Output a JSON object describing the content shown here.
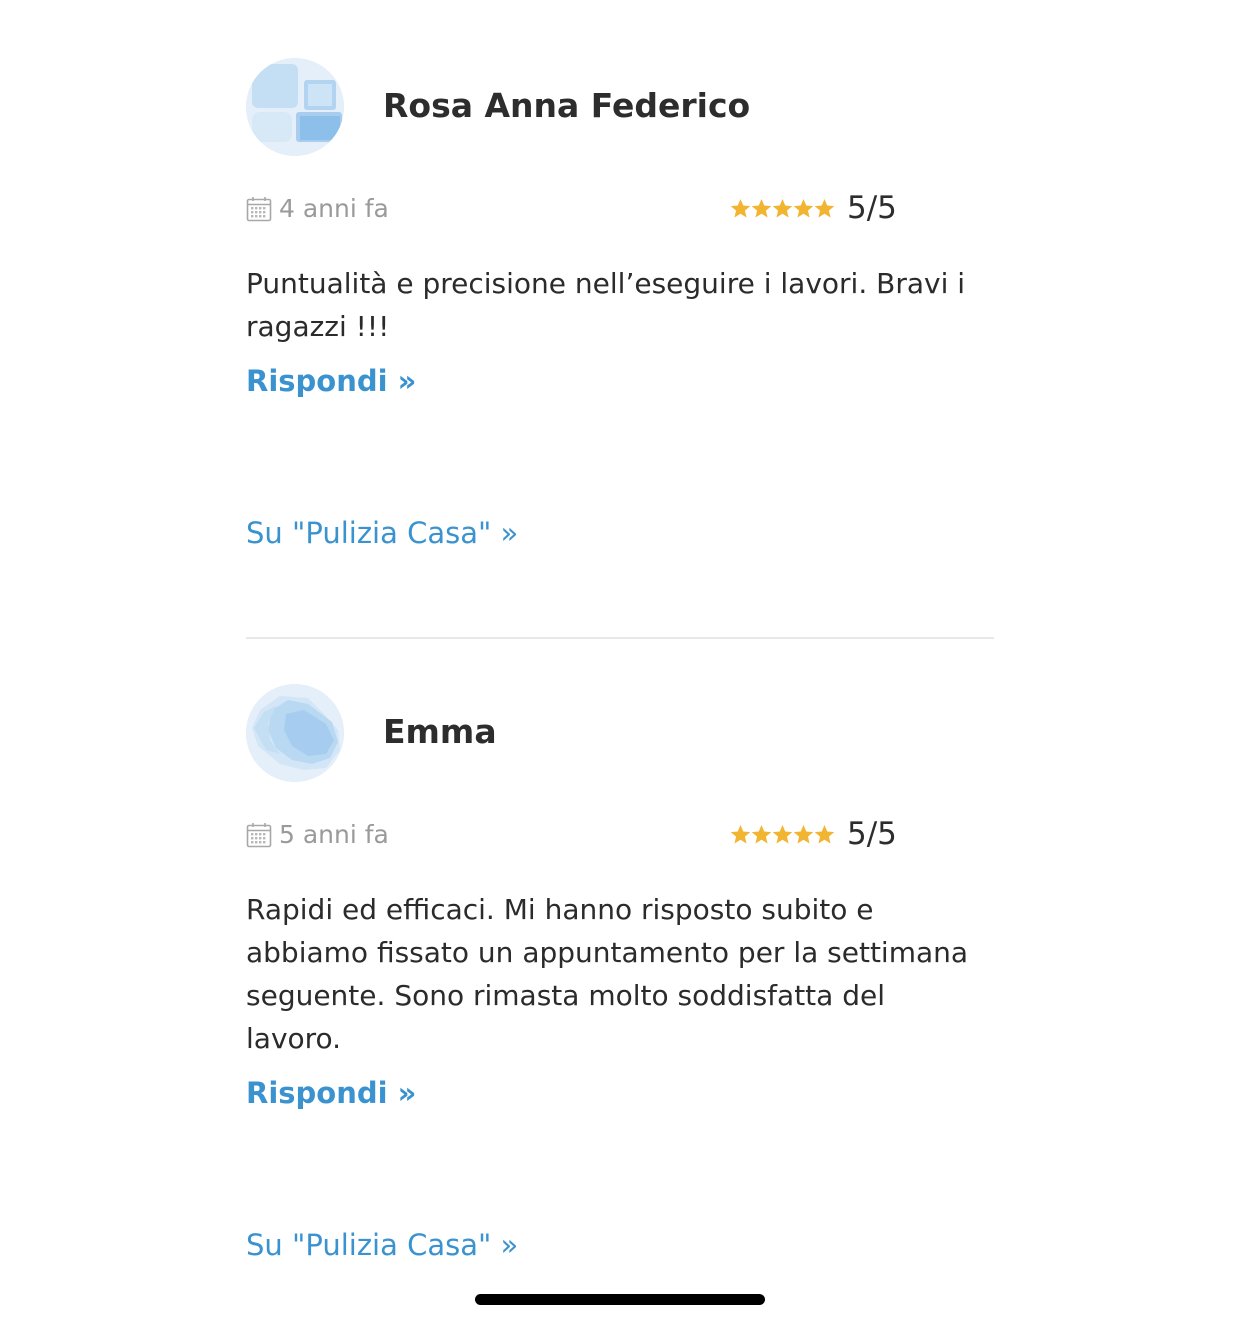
{
  "reviews": [
    {
      "author": "Rosa Anna Federico",
      "date": "4 anni fa",
      "stars": 5,
      "score": "5/5",
      "text": "Puntualità e precisione nell’eseguire i lavori. Bravi i ragazzi !!!",
      "reply_label": "Rispondi »",
      "service_label": "Su \"Pulizia Casa\"  »"
    },
    {
      "author": "Emma",
      "date": "5 anni fa",
      "stars": 5,
      "score": "5/5",
      "text": "Rapidi ed efficaci. Mi hanno risposto subito e abbiamo fissato un appuntamento per la settimana seguente. Sono rimasta molto soddisfatta del lavoro.",
      "reply_label": "Rispondi »",
      "service_label": "Su \"Pulizia Casa\"  »"
    }
  ],
  "colors": {
    "link": "#3a93cf",
    "star": "#f2b531",
    "muted": "#9a9a9a",
    "avatar_light": "#e4eff9",
    "avatar_mid": "#b9d8f2",
    "avatar_dark": "#8cbfe9"
  },
  "icons": {
    "date": "calendar-icon",
    "rating": "star-icon",
    "avatar": "avatar-icon"
  }
}
